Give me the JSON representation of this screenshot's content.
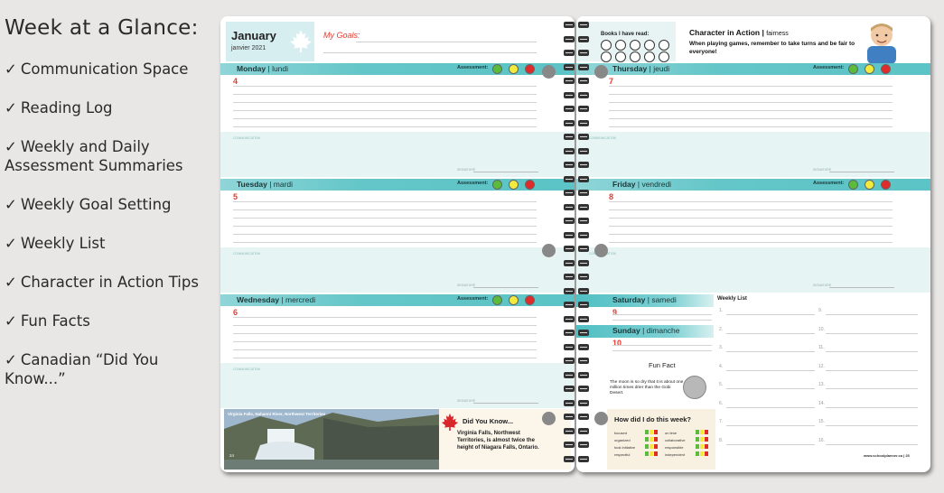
{
  "features": {
    "heading": "Week at a Glance:",
    "items": [
      "Communication Space",
      "Reading Log",
      "Weekly and Daily Assessment Summaries",
      "Weekly Goal Setting",
      "Weekly List",
      "Character in Action Tips",
      "Fun Facts",
      "Canadian “Did You Know...”"
    ],
    "check": "✓"
  },
  "planner": {
    "month": "January",
    "month_sub": "janvier 2021",
    "goals_label": "My Goals:",
    "assessment_label": "Assessment:",
    "comm_label": "COMMUNICATION",
    "sig_label": "SIGNATURE",
    "left_days": [
      {
        "en": "Monday",
        "fr": "lundi",
        "date": "4"
      },
      {
        "en": "Tuesday",
        "fr": "mardi",
        "date": "5"
      },
      {
        "en": "Wednesday",
        "fr": "mercredi",
        "date": "6"
      }
    ],
    "right_days": [
      {
        "en": "Thursday",
        "fr": "jeudi",
        "date": "7"
      },
      {
        "en": "Friday",
        "fr": "vendredi",
        "date": "8"
      }
    ],
    "weekend": [
      {
        "en": "Saturday",
        "fr": "samedi",
        "date": "9"
      },
      {
        "en": "Sunday",
        "fr": "dimanche",
        "date": "10"
      }
    ],
    "photo_caption": "Virginia Falls, Nahanni River, Northwest Territories",
    "left_page_number": "24",
    "did_you_know": {
      "title": "Did You Know...",
      "body": "Virginia Falls, Northwest Territories, is almost twice the height of Niagara Falls, Ontario."
    },
    "books_label": "Books I have read:",
    "character": {
      "title": "Character in Action",
      "title_sub": "fairness",
      "body": "When playing games, remember to take turns and be fair to everyone!"
    },
    "weekly_list_title": "Weekly List",
    "weekly_list_numbers": [
      "1.",
      "2.",
      "3.",
      "4.",
      "5.",
      "6.",
      "7.",
      "8.",
      "9.",
      "10.",
      "11.",
      "12.",
      "13.",
      "14.",
      "15.",
      "16."
    ],
    "fun_fact": {
      "title": "Fun Fact",
      "body": "The moon is so dry that it is about one million times drier than the Gobi Desert."
    },
    "how_did_i_do": {
      "title": "How did I do this week?",
      "items_left": [
        "focused",
        "organized",
        "took initiative",
        "respectful"
      ],
      "items_right": [
        "on time",
        "collaborative",
        "responsible",
        "independent"
      ]
    },
    "site": "www.schoolplanner.ca",
    "right_page_number": "25"
  },
  "colors": {
    "teal": "#5cc3c6",
    "red_accent": "#e63b2e",
    "green": "#5bbb3a",
    "yellow": "#f3ea3b",
    "red": "#e12a2a"
  }
}
